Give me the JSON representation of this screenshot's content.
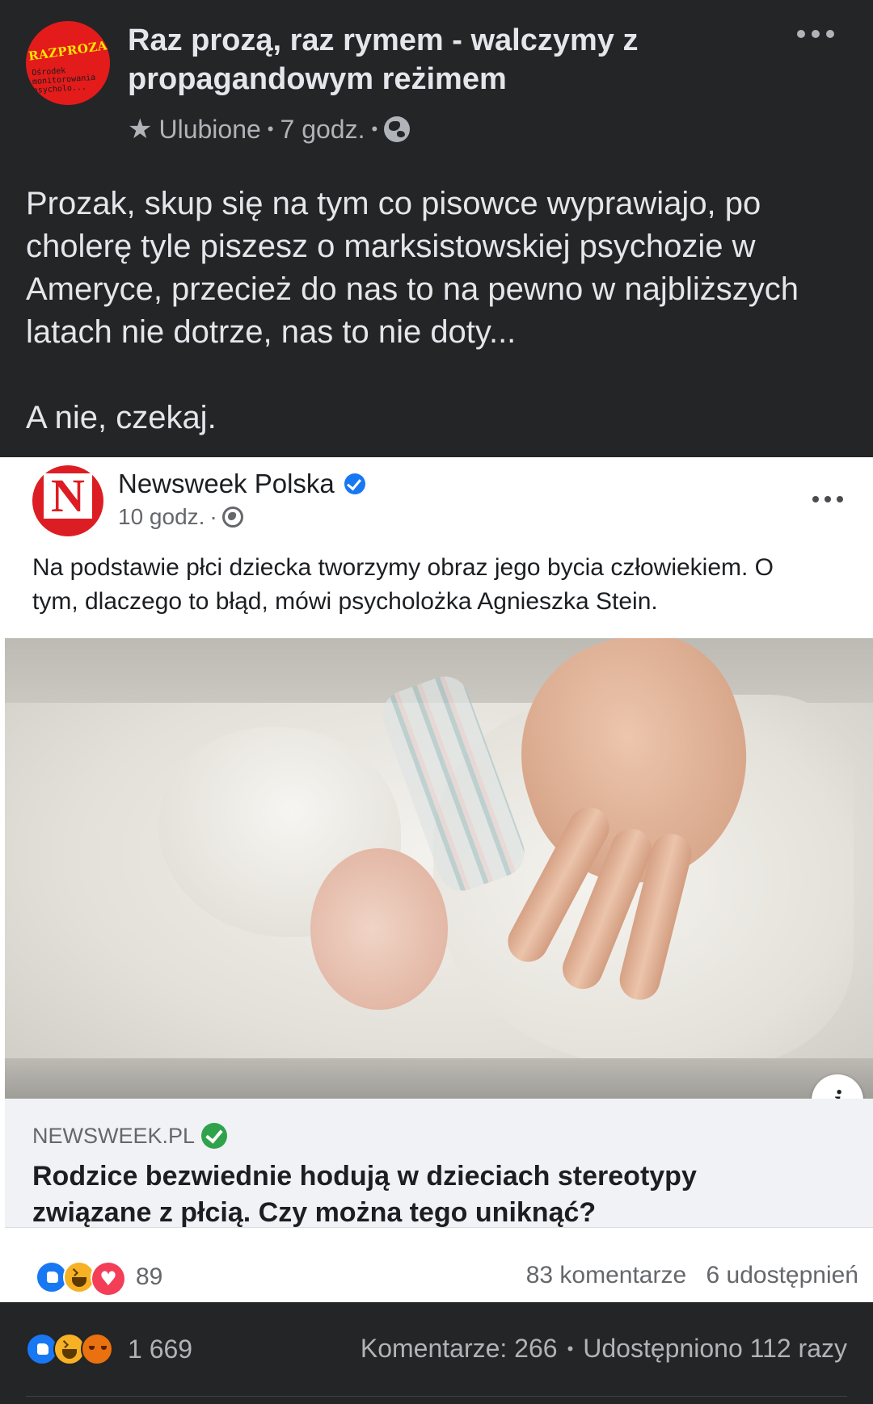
{
  "post": {
    "avatar": {
      "brand": "RAZPROZA",
      "subtitle": "Ośrodek monitorowania psycholo..."
    },
    "page_title": "Raz prozą, raz rymem - walczymy z propagandowym reżimem",
    "meta": {
      "favorites_label": "Ulubione",
      "separator": "•",
      "time": "7 godz.",
      "star_icon": "star-icon",
      "audience_icon": "globe-icon"
    },
    "text_lines": [
      "Prozak, skup się na tym co pisowce wyprawiajo, po",
      "cholerę tyle piszesz o marksistowskiej psychozie w",
      "Ameryce, przecież do nas to na pewno w najbliższych",
      "latach nie dotrze, nas to nie doty..."
    ],
    "text_last": "A nie, czekaj."
  },
  "embed": {
    "author": "Newsweek Polska",
    "logo_letter": "N",
    "time": "10 godz.",
    "separator": "·",
    "text_lines": [
      "Na podstawie płci dziecka tworzymy obraz jego bycia człowiekiem. O",
      "tym, dlaczego to błąd, mówi psycholożka Agnieszka Stein."
    ],
    "info_symbol": "i",
    "link": {
      "domain": "NEWSWEEK.PL",
      "title_lines": [
        "Rodzice bezwiednie hodują w dzieciach stereotypy",
        "związane z płcią. Czy można tego uniknąć?"
      ]
    },
    "reactions": {
      "icons": [
        "like-icon",
        "haha-icon",
        "love-icon"
      ],
      "count": "89",
      "comments": "83 komentarze",
      "shares": "6 udostępnień"
    }
  },
  "footer": {
    "reaction_icons": [
      "like-icon",
      "haha-icon",
      "angry-icon"
    ],
    "reaction_count": "1 669",
    "comments": "Komentarze: 266",
    "separator": "•",
    "shares": "Udostępniono 112 razy"
  },
  "colors": {
    "background": "#242526",
    "text_primary": "#e4e6eb",
    "text_secondary": "#b0b3b8",
    "facebook_blue": "#1877f2",
    "newsweek_red": "#dd1d24",
    "verified_green": "#31a24c"
  }
}
